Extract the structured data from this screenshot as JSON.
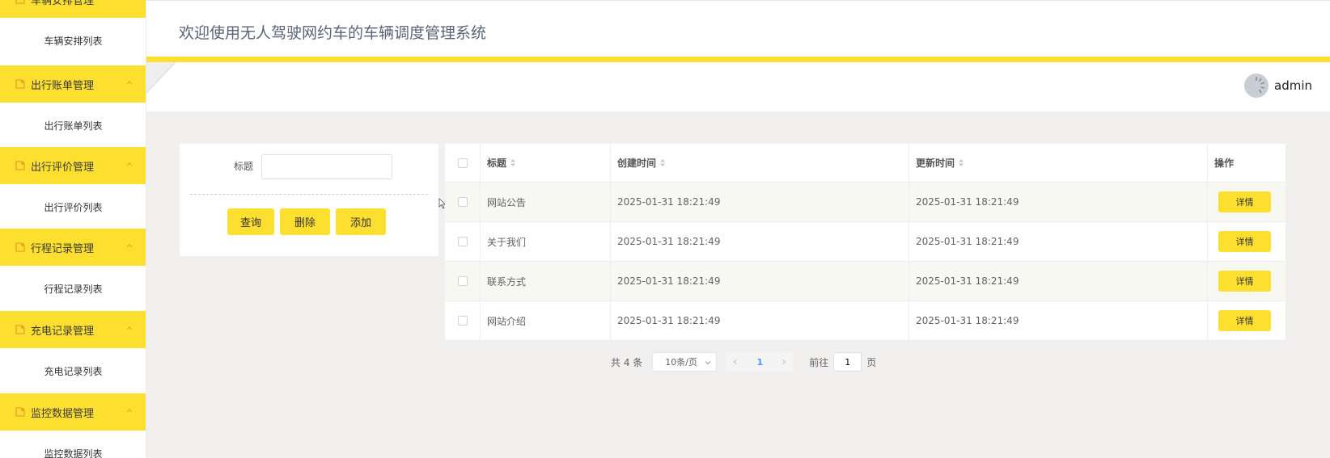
{
  "app": {
    "title": "欢迎使用无人驾驶网约车的车辆调度管理系统"
  },
  "user": {
    "name": "admin"
  },
  "colors": {
    "accent": "#fde02f",
    "link": "#409eff"
  },
  "sidebar": {
    "groups": [
      {
        "label": "车辆安排管理",
        "item": "车辆安排列表",
        "icon": "document-icon"
      },
      {
        "label": "出行账单管理",
        "item": "出行账单列表",
        "icon": "document-icon"
      },
      {
        "label": "出行评价管理",
        "item": "出行评价列表",
        "icon": "document-icon"
      },
      {
        "label": "行程记录管理",
        "item": "行程记录列表",
        "icon": "document-icon"
      },
      {
        "label": "充电记录管理",
        "item": "充电记录列表",
        "icon": "document-icon"
      },
      {
        "label": "监控数据管理",
        "item": "监控数据列表",
        "icon": "document-icon"
      }
    ]
  },
  "search": {
    "title_label": "标题",
    "title_value": "",
    "query_label": "查询",
    "delete_label": "删除",
    "add_label": "添加"
  },
  "table": {
    "columns": {
      "title": "标题",
      "created": "创建时间",
      "updated": "更新时间",
      "op": "操作"
    },
    "detail_label": "详情",
    "rows": [
      {
        "title": "网站公告",
        "created": "2025-01-31 18:21:49",
        "updated": "2025-01-31 18:21:49"
      },
      {
        "title": "关于我们",
        "created": "2025-01-31 18:21:49",
        "updated": "2025-01-31 18:21:49"
      },
      {
        "title": "联系方式",
        "created": "2025-01-31 18:21:49",
        "updated": "2025-01-31 18:21:49"
      },
      {
        "title": "网站介绍",
        "created": "2025-01-31 18:21:49",
        "updated": "2025-01-31 18:21:49"
      }
    ]
  },
  "pagination": {
    "total": "共 4 条",
    "page_size": "10条/页",
    "current_page": "1",
    "goto_label": "前往",
    "goto_value": "1",
    "page_suffix": "页"
  }
}
